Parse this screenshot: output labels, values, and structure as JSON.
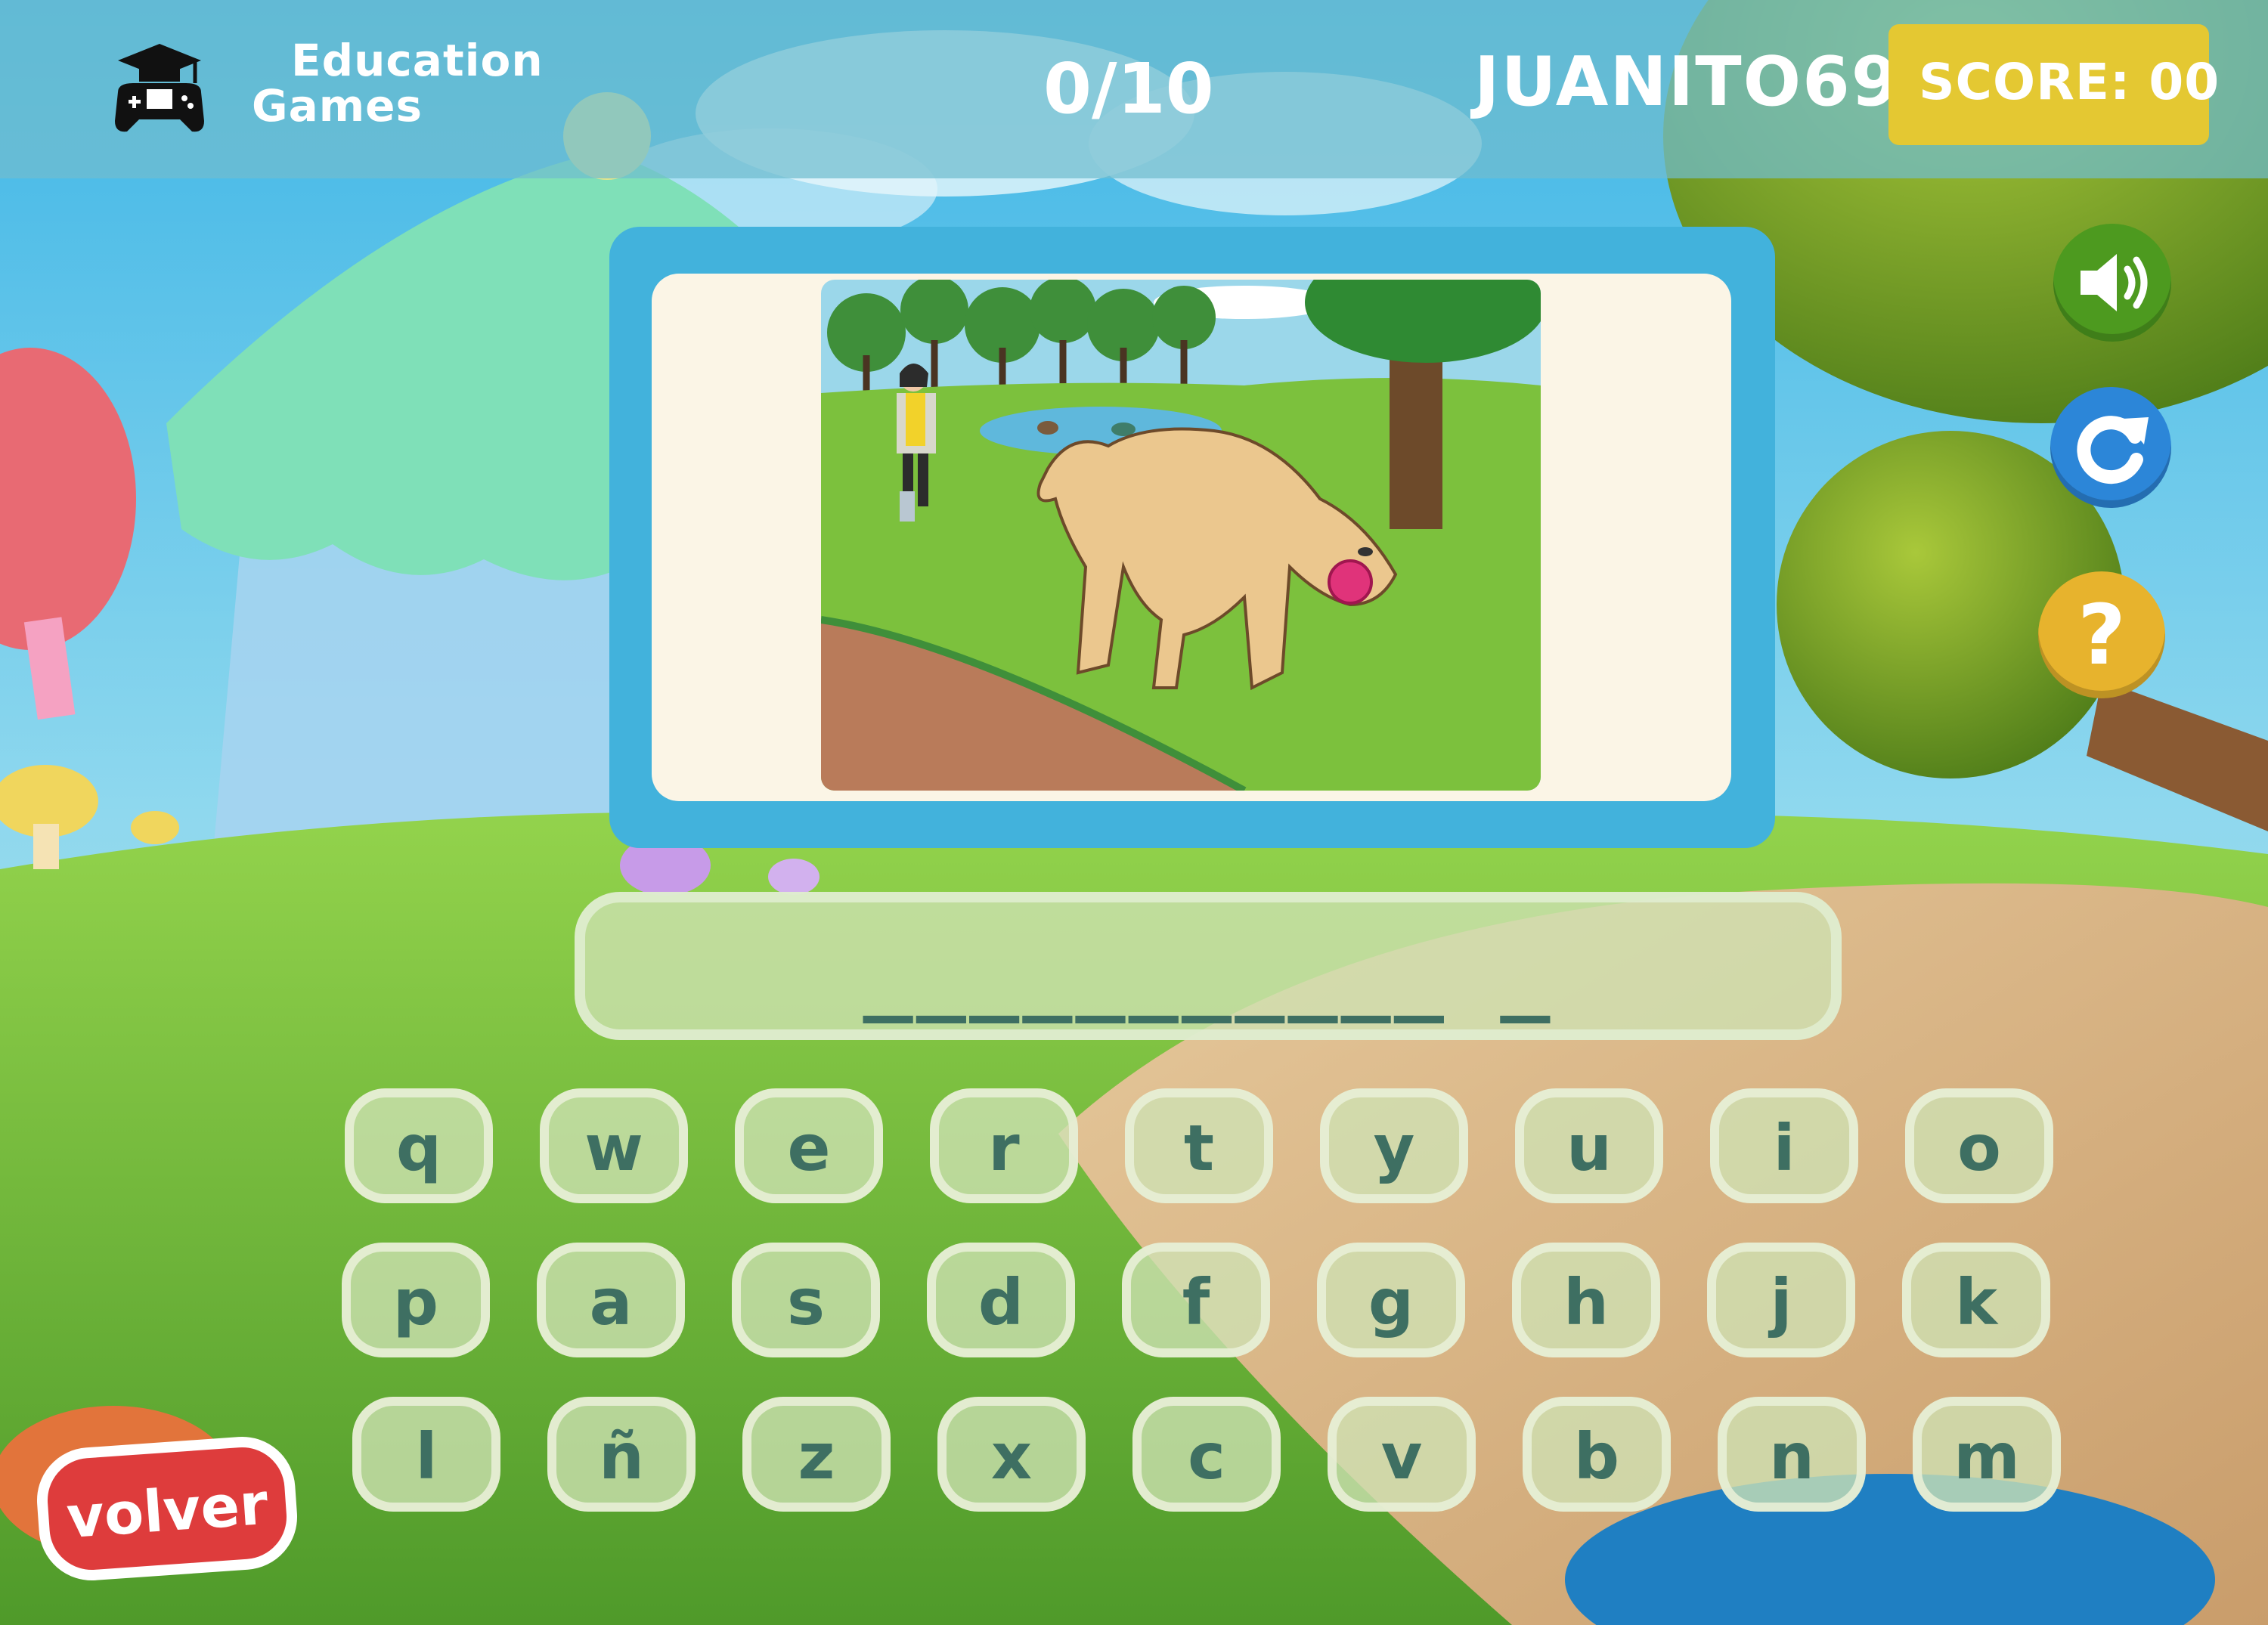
{
  "header": {
    "brand_line1": "Education",
    "brand_line2": "Games",
    "progress": "0/10",
    "username": "JUANITO69",
    "score_label": "SCORE: 00"
  },
  "side_buttons": {
    "sound_icon": "speaker-icon",
    "reload_icon": "reload-icon",
    "help_label": "?"
  },
  "puzzle": {
    "image_subject": "dog-with-ball-in-park",
    "answer_pattern": "___________ _"
  },
  "keyboard": {
    "rows": [
      [
        "q",
        "w",
        "e",
        "r",
        "t",
        "y",
        "u",
        "i",
        "o"
      ],
      [
        "p",
        "a",
        "s",
        "d",
        "f",
        "g",
        "h",
        "j",
        "k"
      ],
      [
        "l",
        "ñ",
        "z",
        "x",
        "c",
        "v",
        "b",
        "n",
        "m"
      ]
    ]
  },
  "footer": {
    "back_label": "volver"
  },
  "colors": {
    "header_bg": "#70bcce",
    "score_bg": "#e4c832",
    "frame": "#42b2dc",
    "key_bg": "#cee2b4",
    "key_text": "#3e6f62",
    "sound_btn": "#4d9a1f",
    "reload_btn": "#2c86d8",
    "help_btn": "#e7b32d",
    "back_btn": "#de3c3c"
  }
}
